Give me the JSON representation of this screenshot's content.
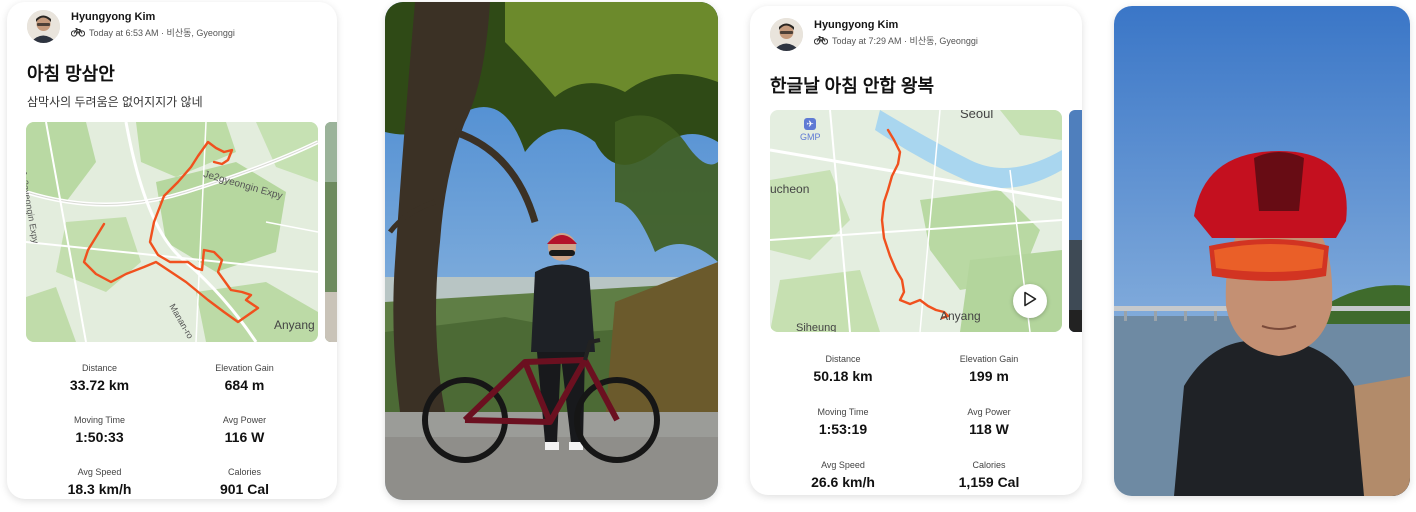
{
  "activities": [
    {
      "author": "Hyungyong Kim",
      "time_location": "Today at 6:53 AM · 비산동, Gyeonggi",
      "title": "아침 망삼안",
      "description": "삼막사의 두려움은 없어지지가 않네",
      "map_labels": [
        "Je2gyeongin Expy",
        "Je2gyeongin Expy",
        "Manan-ro",
        "Anyang"
      ],
      "stats": [
        {
          "label": "Distance",
          "value": "33.72 km"
        },
        {
          "label": "Elevation Gain",
          "value": "684 m"
        },
        {
          "label": "Moving Time",
          "value": "1:50:33"
        },
        {
          "label": "Avg Power",
          "value": "116 W"
        },
        {
          "label": "Avg Speed",
          "value": "18.3 km/h"
        },
        {
          "label": "Calories",
          "value": "901 Cal"
        }
      ]
    },
    {
      "author": "Hyungyong Kim",
      "time_location": "Today at 7:29 AM · 비산동, Gyeonggi",
      "title": "한글날 아침 안합 왕복",
      "map_labels": [
        "GMP",
        "Seoul",
        "ucheon",
        "Anyang",
        "Siheung"
      ],
      "stats": [
        {
          "label": "Distance",
          "value": "50.18 km"
        },
        {
          "label": "Elevation Gain",
          "value": "199 m"
        },
        {
          "label": "Moving Time",
          "value": "1:53:19"
        },
        {
          "label": "Avg Power",
          "value": "118 W"
        },
        {
          "label": "Avg Speed",
          "value": "26.6 km/h"
        },
        {
          "label": "Calories",
          "value": "1,159 Cal"
        }
      ]
    }
  ],
  "colors": {
    "route": "#f0511e",
    "map_land": "#e3eddd",
    "map_park": "#b9d9a3",
    "map_water": "#a9d6ef"
  },
  "icons": {
    "activity_type": "bicycle-icon",
    "video": "play-icon"
  }
}
